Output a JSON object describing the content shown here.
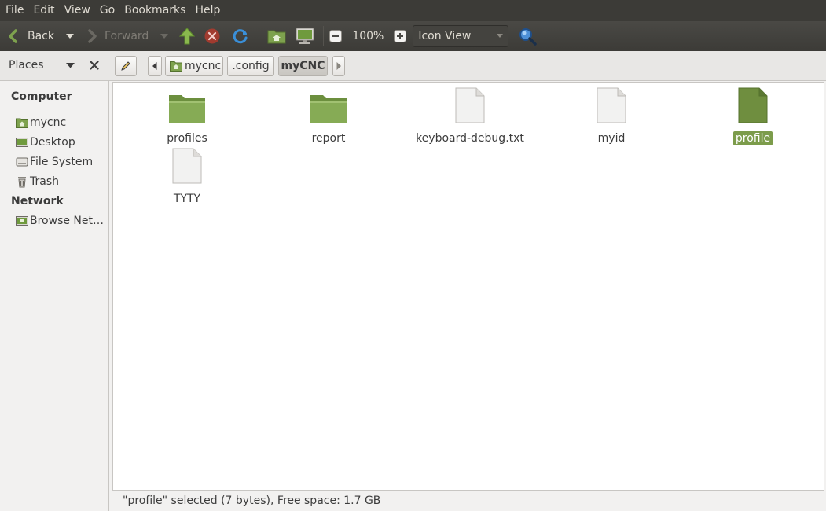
{
  "menubar": {
    "items": [
      "File",
      "Edit",
      "View",
      "Go",
      "Bookmarks",
      "Help"
    ]
  },
  "toolbar": {
    "back_label": "Back",
    "forward_label": "Forward",
    "zoom": "100%",
    "view_mode": "Icon View"
  },
  "location": {
    "places_label": "Places",
    "crumbs": [
      "mycnc",
      ".config",
      "myCNC"
    ]
  },
  "sidebar": {
    "computer_heading": "Computer",
    "computer_items": [
      "mycnc",
      "Desktop",
      "File System",
      "Trash"
    ],
    "network_heading": "Network",
    "network_items": [
      "Browse Net…"
    ]
  },
  "files": [
    {
      "name": "profiles",
      "type": "folder"
    },
    {
      "name": "report",
      "type": "folder"
    },
    {
      "name": "keyboard-debug.txt",
      "type": "file"
    },
    {
      "name": "myid",
      "type": "file"
    },
    {
      "name": "profile",
      "type": "file",
      "selected": true
    },
    {
      "name": "TYTY",
      "type": "file"
    }
  ],
  "status": {
    "text": "\"profile\" selected (7 bytes), Free space: 1.7 GB"
  },
  "colors": {
    "accent": "#7c9c4b",
    "menubar": "#3c3b37",
    "folder": "#7ea24e"
  }
}
